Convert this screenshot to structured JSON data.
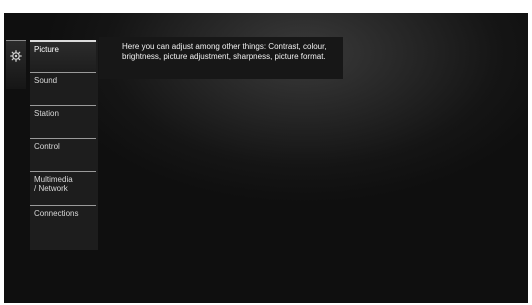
{
  "settings_menu": {
    "items": [
      {
        "label": "Picture",
        "selected": true
      },
      {
        "label": "Sound",
        "selected": false
      },
      {
        "label": "Station",
        "selected": false
      },
      {
        "label": "Control",
        "selected": false
      },
      {
        "label": "Multimedia / Network",
        "line1": "Multimedia",
        "line2": "/ Network",
        "selected": false
      },
      {
        "label": "Connections",
        "selected": false
      }
    ]
  },
  "info": {
    "line1": "Here you can adjust among other things: Contrast, colour,",
    "line2": "brightness, picture adjustment, sharpness, picture format."
  },
  "icons": {
    "settings_tab": "gear-icon"
  },
  "colors": {
    "background": "#1a1a1a",
    "menu_panel": "#1d1d1d",
    "text": "#ffffff"
  }
}
